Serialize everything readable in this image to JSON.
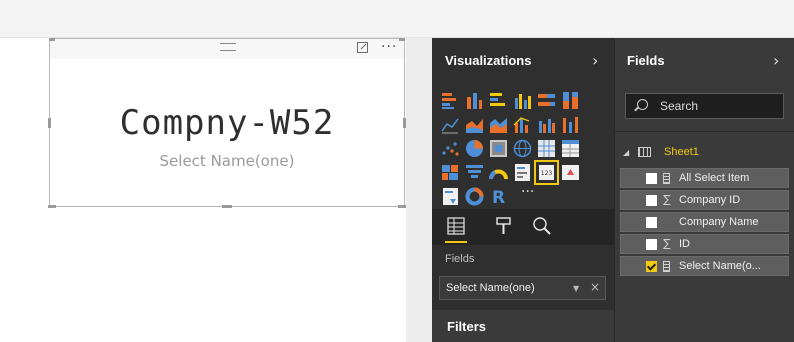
{
  "card": {
    "value": "Compny-W52",
    "label": "Select Name(one)",
    "more_label": "···"
  },
  "visualizations_pane": {
    "title": "Visualizations",
    "collapse_glyph": "›",
    "more_visuals_label": "···",
    "selected_visual": "card-visual-icon",
    "tabs": [
      "fields-tab-icon",
      "format-paint-roller-icon",
      "analytics-magnifier-icon"
    ],
    "wells_label": "Fields",
    "well_value": "Select Name(one)",
    "well_caret": "▼",
    "well_remove": "×",
    "filters_label": "Filters"
  },
  "fields_pane": {
    "title": "Fields",
    "collapse_glyph": "›",
    "search_placeholder": "Search",
    "table_expand_glyph": "◢",
    "table_name": "Sheet1",
    "fields": [
      {
        "name": "All Select Item",
        "type_icon": "calculator-icon",
        "type_glyph": "",
        "checked": false
      },
      {
        "name": "Company ID",
        "type_icon": "sigma-icon",
        "type_glyph": "∑",
        "checked": false
      },
      {
        "name": "Company Name",
        "type_icon": "none",
        "type_glyph": "",
        "checked": false
      },
      {
        "name": "ID",
        "type_icon": "sigma-icon",
        "type_glyph": "∑",
        "checked": false
      },
      {
        "name": "Select Name(o...",
        "type_icon": "calculator-icon",
        "type_glyph": "",
        "checked": true
      }
    ]
  },
  "colors": {
    "accent": "#f2c811",
    "pane_dark": "#2f2f2f",
    "fields_bg": "#3a3a3a",
    "field_item_bg": "#5e5e5e"
  }
}
